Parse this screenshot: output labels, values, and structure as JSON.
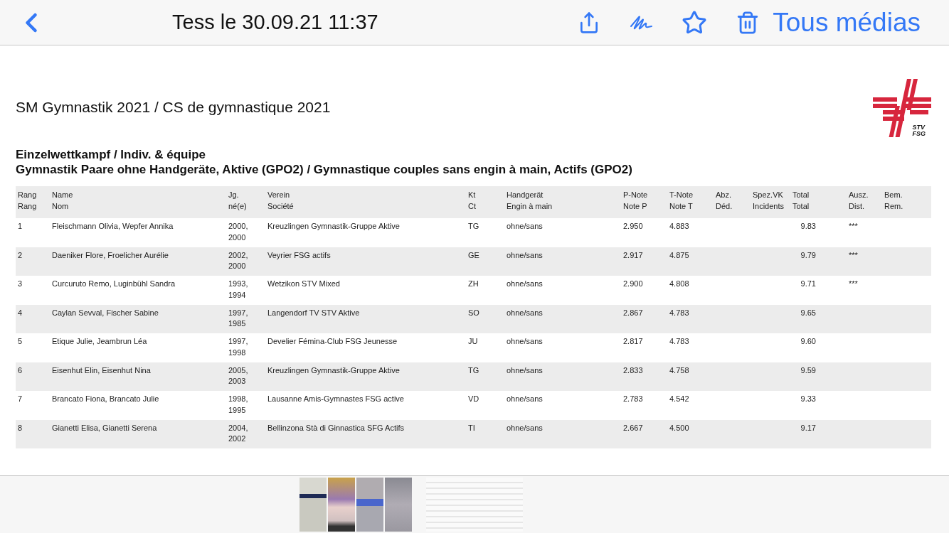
{
  "toolbar": {
    "title": "Tess le 30.09.21 11:37",
    "link": "Tous médias"
  },
  "document": {
    "title": "SM Gymnastik 2021 / CS de gymnastique 2021",
    "logo_text": "STV\nFSG",
    "heading": "Einzelwettkampf / Indiv. & équipe",
    "subheading": "Gymnastik Paare ohne Handgeräte, Aktive (GPO2) / Gymnastique couples sans engin à main, Actifs (GPO2)"
  },
  "table": {
    "columns": [
      {
        "label": "Rang\nRang"
      },
      {
        "label": "Name\nNom"
      },
      {
        "label": "Jg.\nné(e)"
      },
      {
        "label": "Verein\nSociété"
      },
      {
        "label": "Kt\nCt"
      },
      {
        "label": "Handgerät\nEngin à main"
      },
      {
        "label": "P-Note\nNote P"
      },
      {
        "label": "T-Note\nNote T"
      },
      {
        "label": "Abz.\nDéd."
      },
      {
        "label": "Spez.VK\nIncidents"
      },
      {
        "label": "Total\nTotal"
      },
      {
        "label": "Ausz.\nDist."
      },
      {
        "label": "Bem.\nRem."
      }
    ],
    "rows": [
      {
        "rang": "1",
        "name": "Fleischmann Olivia, Wepfer Annika",
        "jg": "2000,\n2000",
        "verein": "Kreuzlingen Gymnastik-Gruppe Aktive",
        "kt": "TG",
        "handgeraet": "ohne/sans",
        "p_note": "2.950",
        "t_note": "4.883",
        "total": "9.83",
        "ausz": "***"
      },
      {
        "rang": "2",
        "name": "Daeniker Flore, Froelicher Aurélie",
        "jg": "2002,\n2000",
        "verein": "Veyrier FSG actifs",
        "kt": "GE",
        "handgeraet": "ohne/sans",
        "p_note": "2.917",
        "t_note": "4.875",
        "total": "9.79",
        "ausz": "***"
      },
      {
        "rang": "3",
        "name": "Curcuruto Remo, Luginbühl Sandra",
        "jg": "1993,\n1994",
        "verein": "Wetzikon STV Mixed",
        "kt": "ZH",
        "handgeraet": "ohne/sans",
        "p_note": "2.900",
        "t_note": "4.808",
        "total": "9.71",
        "ausz": "***"
      },
      {
        "rang": "4",
        "name": "Caylan Sevval, Fischer Sabine",
        "jg": "1997,\n1985",
        "verein": "Langendorf TV STV Aktive",
        "kt": "SO",
        "handgeraet": "ohne/sans",
        "p_note": "2.867",
        "t_note": "4.783",
        "total": "9.65"
      },
      {
        "rang": "5",
        "name": "Etique Julie, Jeambrun Léa",
        "jg": "1997,\n1998",
        "verein": "Develier Fémina-Club FSG Jeunesse",
        "kt": "JU",
        "handgeraet": "ohne/sans",
        "p_note": "2.817",
        "t_note": "4.783",
        "total": "9.60"
      },
      {
        "rang": "6",
        "name": "Eisenhut Elin, Eisenhut Nina",
        "jg": "2005,\n2003",
        "verein": "Kreuzlingen Gymnastik-Gruppe Aktive",
        "kt": "TG",
        "handgeraet": "ohne/sans",
        "p_note": "2.833",
        "t_note": "4.758",
        "total": "9.59"
      },
      {
        "rang": "7",
        "name": "Brancato Fiona, Brancato Julie",
        "jg": "1998,\n1995",
        "verein": "Lausanne Amis-Gymnastes FSG active",
        "kt": "VD",
        "handgeraet": "ohne/sans",
        "p_note": "2.783",
        "t_note": "4.542",
        "total": "9.33"
      },
      {
        "rang": "8",
        "name": "Gianetti Elisa, Gianetti Serena",
        "jg": "2004,\n2002",
        "verein": "Bellinzona Stà di Ginnastica SFG Actifs",
        "kt": "TI",
        "handgeraet": "ohne/sans",
        "p_note": "2.667",
        "t_note": "4.500",
        "total": "9.17"
      }
    ]
  }
}
